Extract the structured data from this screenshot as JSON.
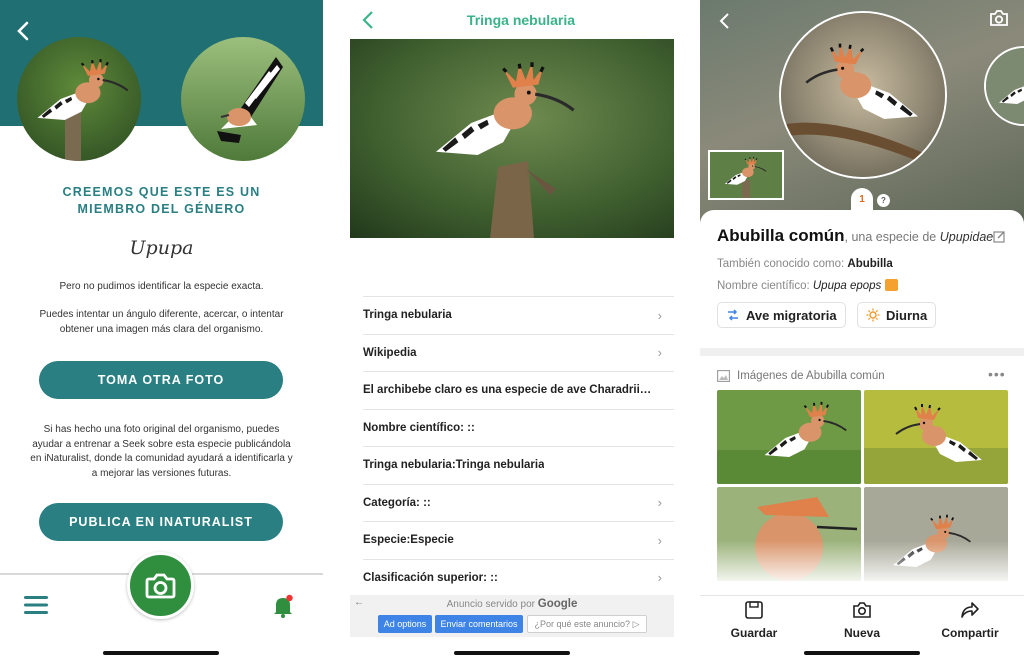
{
  "seek": {
    "headline": "CREEMOS QUE ESTE ES UN MIEMBRO DEL GÉNERO",
    "genus": "Upupa",
    "para1": "Pero no pudimos identificar la especie exacta.",
    "para2": "Puedes intentar un ángulo diferente, acercar, o intentar obtener una imagen más clara del organismo.",
    "retake_button": "TOMA OTRA FOTO",
    "para3": "Si has hecho una foto original del organismo, puedes ayudar a entrenar a Seek sobre esta especie publicándola en iNaturalist, donde la comunidad ayudará a identificarla y a mejorar las versiones futuras.",
    "publish_button": "PUBLICA EN INATURALIST",
    "icons": [
      "back-icon",
      "menu-icon",
      "camera-icon",
      "bell-icon"
    ],
    "colors": {
      "teal": "#1f6f73",
      "accent": "#2a7f83",
      "green": "#2f8f3f"
    }
  },
  "tringa": {
    "title": "Tringa nebularia",
    "rows": [
      {
        "label": "Tringa nebularia",
        "chevron": true
      },
      {
        "label": "Wikipedia",
        "chevron": true
      },
      {
        "label": "El archibebe claro es una especie de ave Charadriif...",
        "chevron": false
      },
      {
        "label": "Nombre científico: ::",
        "chevron": false
      },
      {
        "label": "Tringa nebularia:Tringa nebularia",
        "chevron": false
      },
      {
        "label": "Categoría: ::",
        "chevron": true
      },
      {
        "label": "Especie:Especie",
        "chevron": true
      },
      {
        "label": "Clasificación superior: ::",
        "chevron": true
      }
    ],
    "ad": {
      "served_prefix": "Anuncio servido por",
      "served_brand": "Google",
      "btn_options": "Ad options",
      "btn_feedback": "Enviar comentarios",
      "btn_why": "¿Por qué este anuncio? ▷"
    },
    "colors": {
      "title": "#3bb38a",
      "ad_button": "#3d84e6"
    }
  },
  "abubilla": {
    "pager_current": "1",
    "pager_other": "?",
    "name": "Abubilla común",
    "species_prefix": ", una especie de ",
    "family": "Upupidae",
    "aka_label": "También conocido como: ",
    "aka_value": "Abubilla",
    "sci_label": "Nombre científico: ",
    "sci_value": "Upupa epops",
    "pill_migratory": "Ave migratoria",
    "pill_diurnal": "Diurna",
    "images_title": "Imágenes de Abubilla común",
    "more": "•••",
    "tabs": {
      "save": "Guardar",
      "new": "Nueva",
      "share": "Compartir"
    },
    "colors": {
      "orange": "#e36b1f",
      "speaker": "#f4a12f"
    }
  }
}
